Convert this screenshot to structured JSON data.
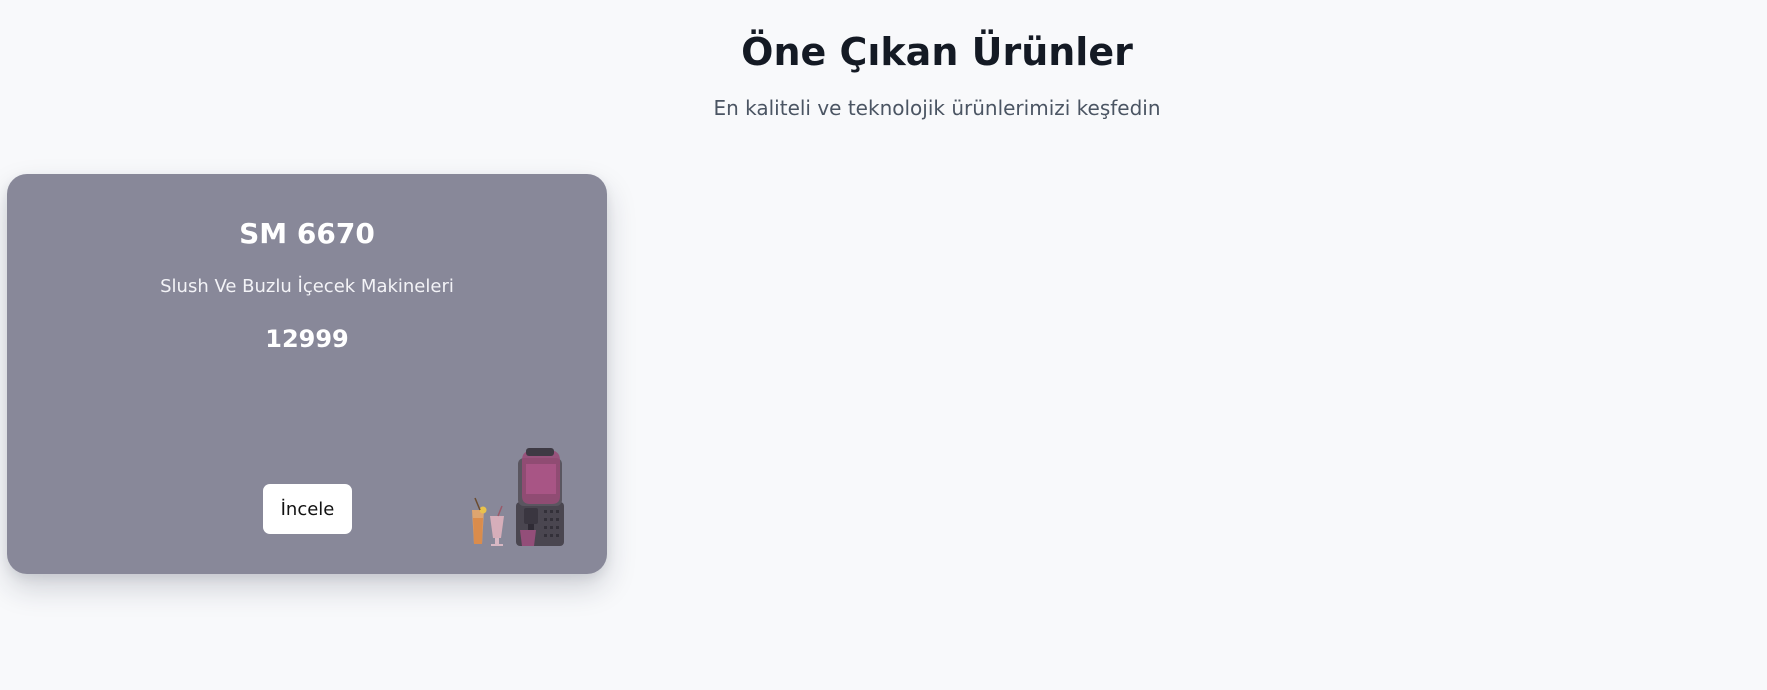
{
  "header": {
    "title": "Öne Çıkan Ürünler",
    "subtitle": "En kaliteli ve teknolojik ürünlerimizi keşfedin"
  },
  "products": [
    {
      "name": "SM 6670",
      "category": "Slush Ve Buzlu İçecek Makineleri",
      "price": "12999",
      "button_label": "İncele",
      "image_icon": "slush-machine-image"
    }
  ],
  "colors": {
    "background": "#f8f9fb",
    "card": "#888899",
    "title": "#141a24",
    "subtitle": "#4b5563",
    "button": "#ffffff"
  }
}
